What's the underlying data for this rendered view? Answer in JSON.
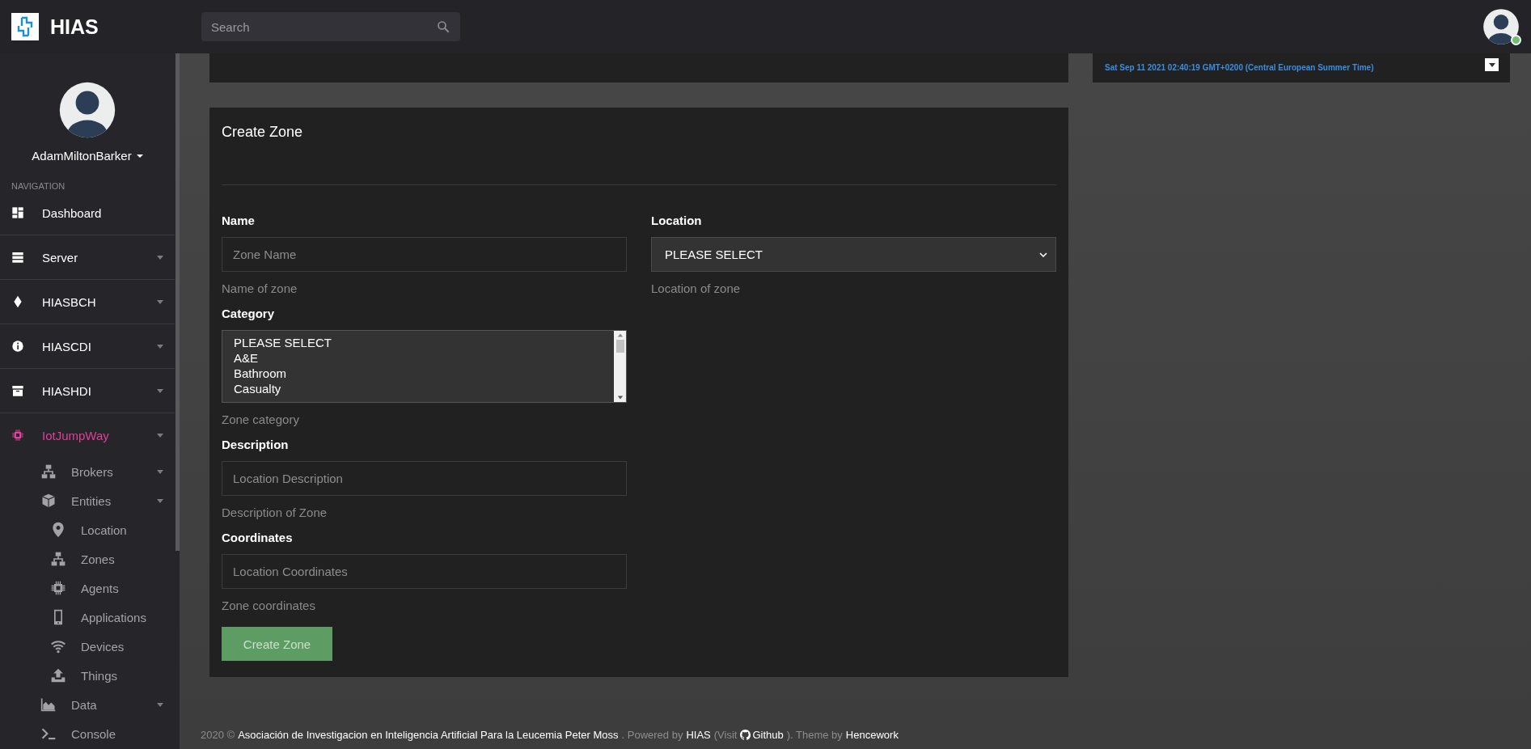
{
  "header": {
    "brand": "HIAS",
    "search": {
      "placeholder": "Search"
    },
    "user_online": true
  },
  "sidebar": {
    "user_name": "AdamMiltonBarker",
    "section_label": "NAVIGATION",
    "items": [
      {
        "label": "Dashboard",
        "selected": false,
        "dropdown": false
      },
      {
        "label": "Server",
        "selected": false,
        "dropdown": true
      },
      {
        "label": "HIASBCH",
        "selected": false,
        "dropdown": true
      },
      {
        "label": "HIASCDI",
        "selected": false,
        "dropdown": true
      },
      {
        "label": "HIASHDI",
        "selected": false,
        "dropdown": true
      },
      {
        "label": "IotJumpWay",
        "selected": true,
        "dropdown": true,
        "children": [
          {
            "label": "Brokers",
            "selected": false,
            "dropdown": true
          },
          {
            "label": "Entities",
            "selected": false,
            "dropdown": true,
            "children": [
              {
                "label": "Location",
                "selected": false,
                "dropdown": false
              },
              {
                "label": "Zones",
                "selected": false,
                "dropdown": false
              },
              {
                "label": "Agents",
                "selected": false,
                "dropdown": false
              },
              {
                "label": "Applications",
                "selected": false,
                "dropdown": false
              },
              {
                "label": "Devices",
                "selected": false,
                "dropdown": false
              },
              {
                "label": "Things",
                "selected": false,
                "dropdown": false
              }
            ]
          },
          {
            "label": "Data",
            "selected": false,
            "dropdown": true
          },
          {
            "label": "Console",
            "selected": false,
            "dropdown": false
          }
        ]
      }
    ]
  },
  "time_panel": {
    "timestamp": "Sat Sep 11 2021 02:40:19 GMT+0200 (Central European Summer Time)"
  },
  "form": {
    "title": "Create Zone",
    "fields": [
      {
        "kind": "text",
        "label": "Name",
        "placeholder": "Zone Name",
        "help": "Name of zone"
      },
      {
        "kind": "select",
        "label": "Location",
        "value": "PLEASE SELECT",
        "help": "Location of zone"
      },
      {
        "kind": "listbox",
        "label": "Category",
        "options": [
          "PLEASE SELECT",
          "A&E",
          "Bathroom",
          "Casualty"
        ],
        "help": "Zone category"
      },
      {
        "kind": "text",
        "label": "Description",
        "placeholder": "Location Description",
        "help": "Description of Zone"
      },
      {
        "kind": "text",
        "label": "Coordinates",
        "placeholder": "Location Coordinates",
        "help": "Zone coordinates"
      }
    ],
    "submit": "Create Zone"
  },
  "footer": [
    {
      "text": "2020 ©",
      "link": false
    },
    {
      "text": "Asociación de Investigacion en Inteligencia Artificial Para la Leucemia Peter Moss",
      "link": true
    },
    {
      "text": ". Powered by",
      "link": false
    },
    {
      "text": "HIAS",
      "link": true
    },
    {
      "text": "(Visit",
      "link": false
    },
    {
      "text": "Github",
      "link": true,
      "icon": true
    },
    {
      "text": "). Theme by",
      "link": false
    },
    {
      "text": "Hencework",
      "link": true
    }
  ]
}
